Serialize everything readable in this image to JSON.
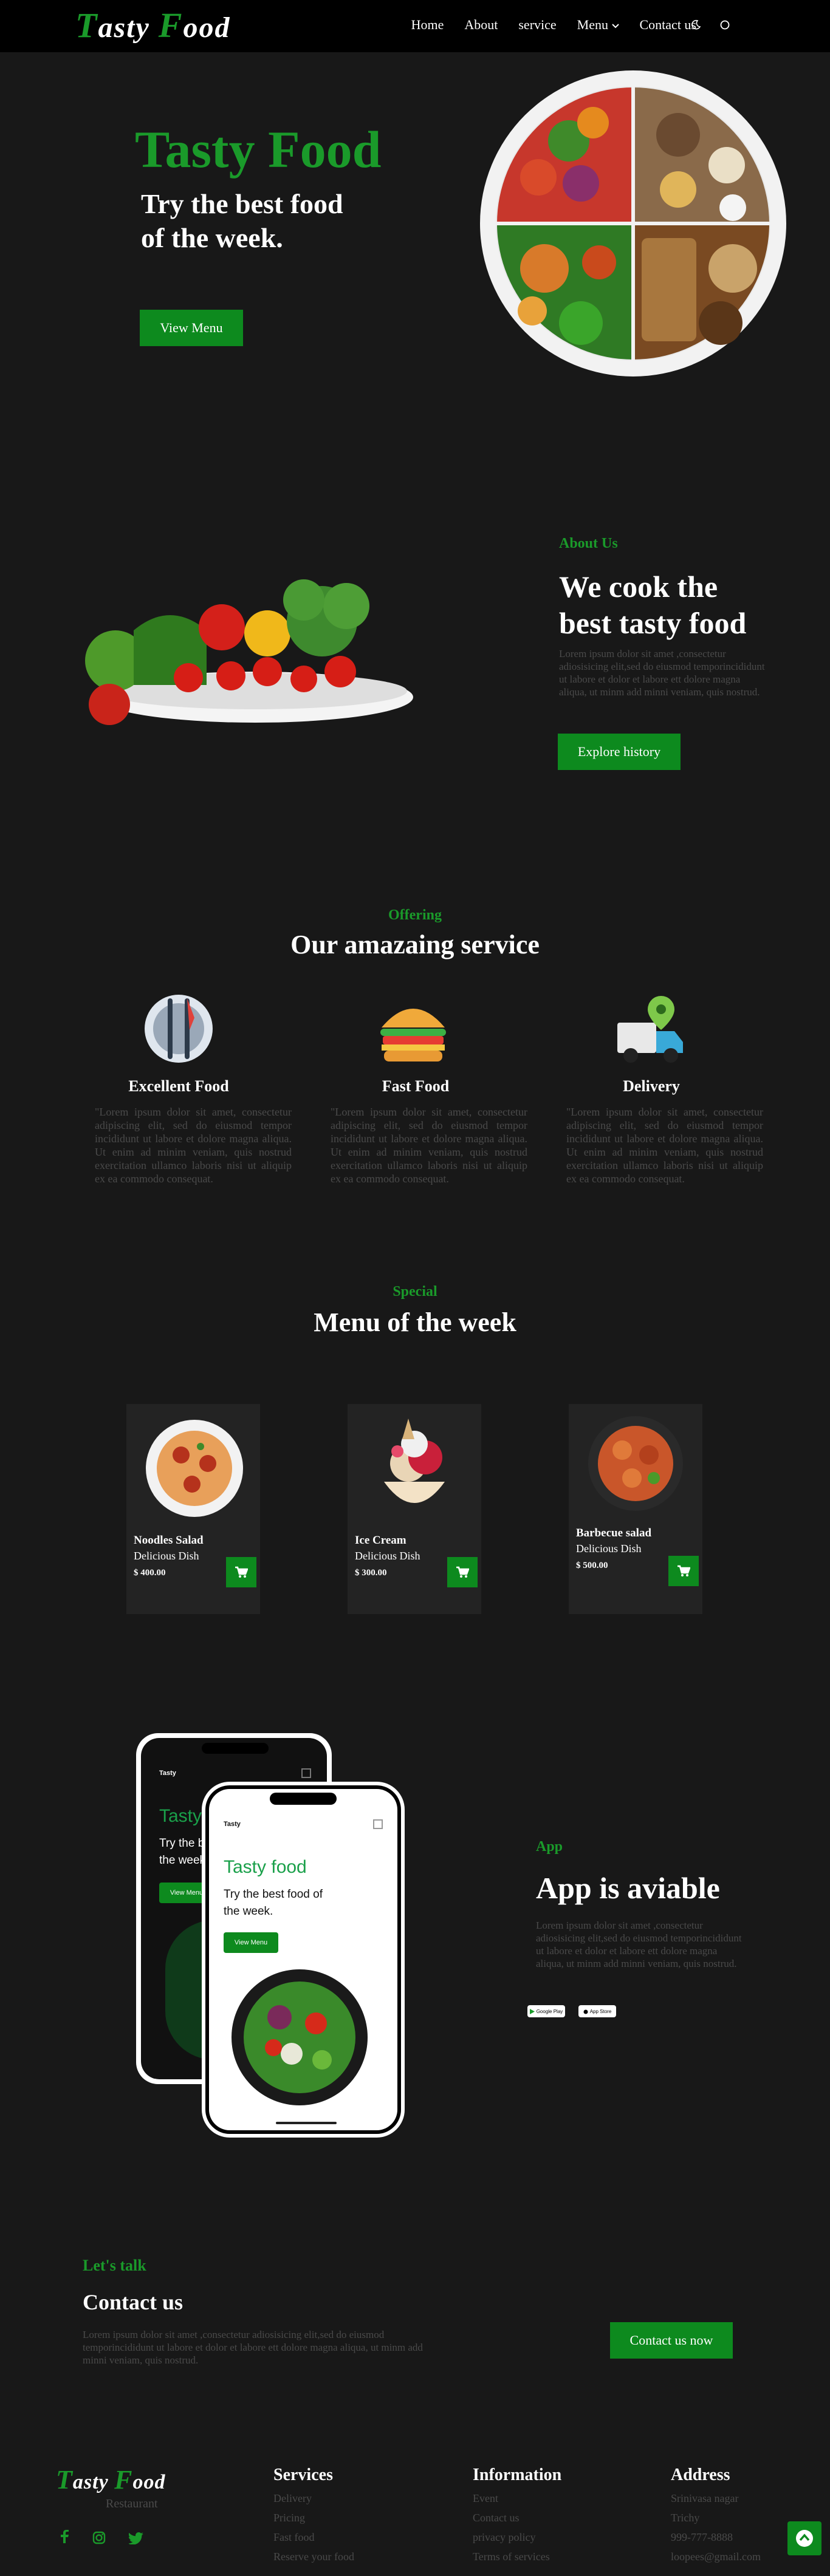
{
  "nav": {
    "logo_first": "T",
    "logo_word1": "asty ",
    "logo_second": "F",
    "logo_word2": "ood",
    "links": [
      "Home",
      "About",
      "service",
      "Menu",
      "Contact us"
    ],
    "menu_chevron": "chevron-down-icon",
    "icons": [
      "moon-icon",
      "circle-icon"
    ]
  },
  "hero": {
    "title": "Tasty Food",
    "subtitle_line1": "Try the best food",
    "subtitle_line2": "of the week.",
    "button": "View Menu"
  },
  "about": {
    "eyebrow": "About Us",
    "title_line1": "We cook the",
    "title_line2": "best tasty food",
    "text": "Lorem ipsum dolor sit amet ,consectetur adiosisicing elit,sed do eiusmod temporincididunt ut labore et dolor et labore ett dolore magna aliqua, ut minm add minni veniam, quis nostrud.",
    "button": "Explore history"
  },
  "services": {
    "eyebrow": "Offering",
    "title": "Our amazaing service",
    "items": [
      {
        "title": "Excellent Food",
        "icon": "cutlery-plate-icon",
        "text": "\"Lorem ipsum dolor sit amet, consectetur adipiscing elit, sed do eiusmod tempor incididunt ut labore et dolore magna aliqua. Ut enim ad minim veniam, quis nostrud exercitation ullamco laboris nisi ut aliquip ex ea commodo consequat."
      },
      {
        "title": "Fast Food",
        "icon": "burger-icon",
        "text": "\"Lorem ipsum dolor sit amet, consectetur adipiscing elit, sed do eiusmod tempor incididunt ut labore et dolore magna aliqua. Ut enim ad minim veniam, quis nostrud exercitation ullamco laboris nisi ut aliquip ex ea commodo consequat."
      },
      {
        "title": "Delivery",
        "icon": "delivery-truck-icon",
        "text": "\"Lorem ipsum dolor sit amet, consectetur adipiscing elit, sed do eiusmod tempor incididunt ut labore et dolore magna aliqua. Ut enim ad minim veniam, quis nostrud exercitation ullamco laboris nisi ut aliquip ex ea commodo consequat."
      }
    ]
  },
  "menu": {
    "eyebrow": "Special",
    "title": "Menu of the week",
    "items": [
      {
        "name": "Noodles Salad",
        "sub": "Delicious Dish",
        "price": "$ 400.00"
      },
      {
        "name": "Ice Cream",
        "sub": "Delicious Dish",
        "price": "$ 300.00"
      },
      {
        "name": "Barbecue salad",
        "sub": "Delicious Dish",
        "price": "$ 500.00"
      }
    ]
  },
  "app": {
    "eyebrow": "App",
    "title": "App is aviable",
    "text": "Lorem ipsum dolor sit amet ,consectetur adiosisicing elit,sed do eiusmod temporincididunt ut labore et dolor et labore ett dolore magna aliqua, ut minm add minni veniam, quis nostrud.",
    "store_buttons": [
      "Google Play",
      "App Store"
    ],
    "phone_back": {
      "brand": "Tasty",
      "title": "Tasty",
      "line1": "Try the b",
      "line2": "the week",
      "button": "View Menu"
    },
    "phone_front": {
      "brand": "Tasty",
      "title": "Tasty food",
      "line1": "Try the best food of",
      "line2": "the week.",
      "button": "View Menu"
    }
  },
  "contact": {
    "eyebrow": "Let's talk",
    "title": "Contact us",
    "text": "Lorem ipsum dolor sit amet ,consectetur adiosisicing elit,sed do eiusmod temporincididunt ut labore et dolor et labore ett dolore magna aliqua, ut minm add minni veniam, quis nostrud.",
    "button": "Contact us now"
  },
  "footer": {
    "logo_first": "T",
    "logo_word1": "asty ",
    "logo_second": "F",
    "logo_word2": "ood",
    "tagline": "Restaurant",
    "social_icons": [
      "facebook-icon",
      "instagram-icon",
      "twitter-icon"
    ],
    "columns": [
      {
        "title": "Services",
        "links": [
          "Delivery",
          "Pricing",
          "Fast food",
          "Reserve your food"
        ]
      },
      {
        "title": "Information",
        "links": [
          "Event",
          "Contact us",
          "privacy policy",
          "Terms of services"
        ]
      },
      {
        "title": "Address",
        "links": [
          "Srinivasa nagar",
          "Trichy",
          "999-777-8888",
          "loopees@gmail.com"
        ]
      }
    ],
    "scroll_top_icon": "arrow-up-circle-icon"
  },
  "colors": {
    "accent": "#0d8a1e",
    "accent_text": "#1a9a2a",
    "bg": "#181818",
    "nav_bg": "#000000",
    "card_bg": "#232323",
    "muted_text": "#4a4a4a"
  }
}
